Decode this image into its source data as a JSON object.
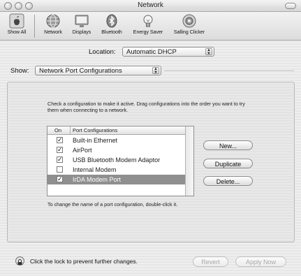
{
  "window": {
    "title": "Network"
  },
  "toolbar": {
    "items": [
      {
        "label": "Show All",
        "icon": "apple-icon"
      },
      {
        "label": "Network",
        "icon": "network-globe-icon"
      },
      {
        "label": "Displays",
        "icon": "display-icon"
      },
      {
        "label": "Bluetooth",
        "icon": "bluetooth-icon"
      },
      {
        "label": "Energy Saver",
        "icon": "lightbulb-icon"
      },
      {
        "label": "Salling Clicker",
        "icon": "clicker-icon"
      }
    ]
  },
  "location": {
    "label": "Location:",
    "value": "Automatic DHCP"
  },
  "show": {
    "label": "Show:",
    "value": "Network Port Configurations"
  },
  "instructions": "Check a configuration to make it active. Drag configurations into the order you want to try them when connecting to a network.",
  "table": {
    "headers": {
      "on": "On",
      "name": "Port Configurations"
    },
    "rows": [
      {
        "name": "Built-in Ethernet",
        "checked": true,
        "selected": false
      },
      {
        "name": "AirPort",
        "checked": true,
        "selected": false
      },
      {
        "name": "USB Bluetooth Modem Adaptor",
        "checked": true,
        "selected": false
      },
      {
        "name": "Internal Modem",
        "checked": false,
        "selected": false
      },
      {
        "name": "IrDA Modem Port",
        "checked": true,
        "selected": true
      }
    ]
  },
  "buttons": {
    "new": "New...",
    "duplicate": "Duplicate",
    "delete": "Delete..."
  },
  "hint": "To change the name of a port configuration, double-click it.",
  "footer": {
    "lock_text": "Click the lock to prevent further changes.",
    "revert": "Revert",
    "apply": "Apply Now"
  },
  "checkmark": "✓"
}
